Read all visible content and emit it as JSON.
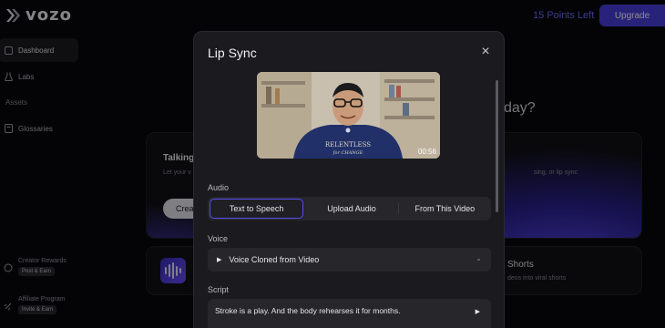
{
  "app": {
    "logo_text": "vozo"
  },
  "header": {
    "points": "15 Points Left",
    "upgrade_label": "Upgrade"
  },
  "sidebar": {
    "items": [
      {
        "label": "Dashboard",
        "icon": "grid-icon"
      },
      {
        "label": "Labs",
        "icon": "flask-icon"
      }
    ],
    "assets_label": "Assets",
    "glossaries_label": "Glossaries",
    "creator_rewards": {
      "label": "Creator Rewards",
      "pill": "Post & Earn"
    },
    "affiliate": {
      "label": "Affiliate Program",
      "pill": "Invite & Earn"
    }
  },
  "background": {
    "heading_suffix": "day?",
    "card_title": "Talking",
    "card_sub": "Let your v",
    "card_button": "Crea",
    "card_hint": "sing, or lip sync",
    "shorts_title": "Shorts",
    "shorts_sub": "deos into viral shorts"
  },
  "modal": {
    "title": "Lip Sync",
    "video": {
      "duration": "00:56",
      "shirt_text_1": "RELENTLESS",
      "shirt_text_2": "for CHANGE"
    },
    "audio_label": "Audio",
    "audio_tabs": [
      "Text to Speech",
      "Upload Audio",
      "From This Video"
    ],
    "voice_label": "Voice",
    "voice_value": "Voice Cloned from Video",
    "script_label": "Script",
    "script_text": "Stroke is a play. And the body rehearses it for months."
  },
  "colors": {
    "accent": "#4c3fe0",
    "points": "#6b6bff"
  }
}
